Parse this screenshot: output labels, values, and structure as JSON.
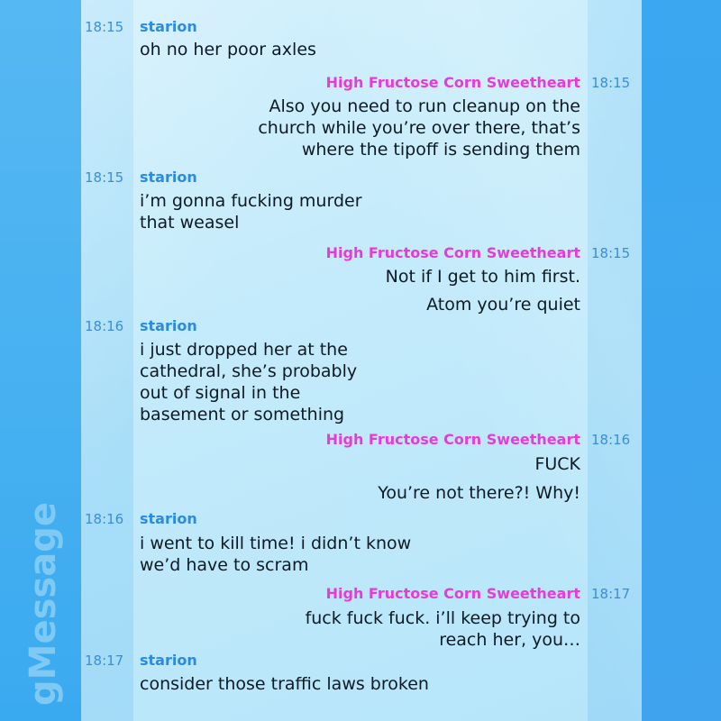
{
  "app": {
    "logo_text": "gMessage"
  },
  "colors": {
    "starion": "#2a8be0",
    "hfcs": "#e83bd6",
    "timestamp": "#3b8ed6"
  },
  "messages": [
    {
      "sender": "starion",
      "time": "18:15",
      "lines": [
        "oh no her poor axles"
      ]
    },
    {
      "sender": "High Fructose Corn Sweetheart",
      "time": "18:15",
      "lines": [
        "Also you need to run cleanup on the",
        "church while you’re over there, that’s",
        "where the tipoff is sending them"
      ]
    },
    {
      "sender": "starion",
      "time": "18:15",
      "lines": [
        "i’m gonna fucking murder",
        "that weasel"
      ]
    },
    {
      "sender": "High Fructose Corn Sweetheart",
      "time": "18:15",
      "lines": [
        "Not if I get to him first."
      ],
      "extra": [
        "Atom you’re quiet"
      ]
    },
    {
      "sender": "starion",
      "time": "18:16",
      "lines": [
        "i just dropped her at the",
        "cathedral, she’s probably",
        "out of signal in the",
        "basement or something"
      ]
    },
    {
      "sender": "High Fructose Corn Sweetheart",
      "time": "18:16",
      "lines": [
        "FUCK"
      ],
      "extra": [
        "You’re not there?! Why!"
      ]
    },
    {
      "sender": "starion",
      "time": "18:16",
      "lines": [
        "i went to kill time! i didn’t know",
        "we’d have to scram"
      ]
    },
    {
      "sender": "High Fructose Corn Sweetheart",
      "time": "18:17",
      "lines": [
        "fuck fuck fuck. i’ll keep trying to",
        "reach her, you…"
      ]
    },
    {
      "sender": "starion",
      "time": "18:17",
      "lines": [
        "consider those traffic laws broken"
      ]
    }
  ]
}
